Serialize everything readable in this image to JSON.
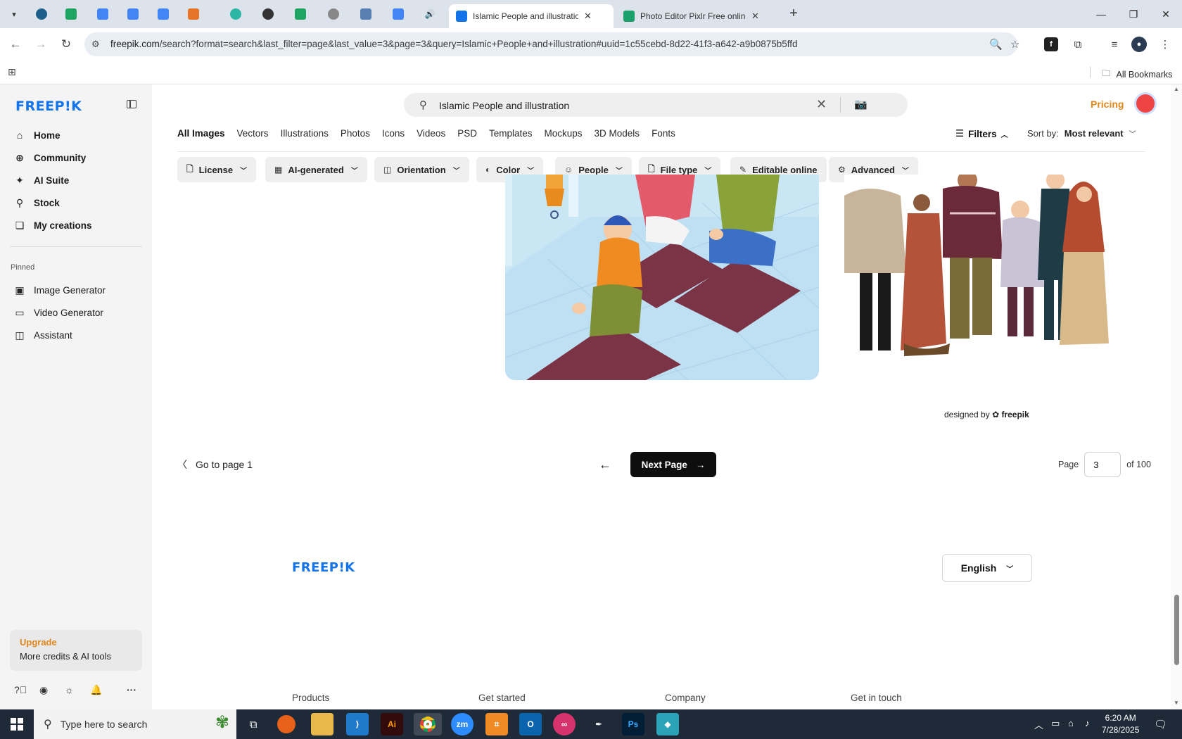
{
  "browser": {
    "tabs": [
      {
        "title": "Islamic People and illustration",
        "active": true
      },
      {
        "title": "Photo Editor Pixlr Free online Im",
        "active": false
      }
    ],
    "url_host": "freepik.com",
    "url_path": "/search?format=search&last_filter=page&last_value=3&page=3&query=Islamic+People+and+illustration#uuid=1c55cebd-8d22-41f3-a642-a9b0875b5ffd",
    "all_bookmarks": "All Bookmarks"
  },
  "sidebar": {
    "logo": "FREEP!K",
    "items": [
      {
        "label": "Home",
        "icon": "home-icon"
      },
      {
        "label": "Community",
        "icon": "globe-icon"
      },
      {
        "label": "AI Suite",
        "icon": "sparkle-icon"
      },
      {
        "label": "Stock",
        "icon": "search-icon"
      },
      {
        "label": "My creations",
        "icon": "creations-icon"
      }
    ],
    "pinned_label": "Pinned",
    "pinned": [
      {
        "label": "Image Generator",
        "icon": "image-icon"
      },
      {
        "label": "Video Generator",
        "icon": "video-icon"
      },
      {
        "label": "Assistant",
        "icon": "chat-icon"
      }
    ],
    "upgrade_title": "Upgrade",
    "upgrade_text": "More credits & AI tools"
  },
  "header": {
    "search_query": "Islamic People and illustration",
    "pricing": "Pricing"
  },
  "categories": [
    "All Images",
    "Vectors",
    "Illustrations",
    "Photos",
    "Icons",
    "Videos",
    "PSD",
    "Templates",
    "Mockups",
    "3D Models",
    "Fonts"
  ],
  "filters_label": "Filters",
  "sort": {
    "label": "Sort by:",
    "value": "Most relevant"
  },
  "chips": [
    "License",
    "AI-generated",
    "Orientation",
    "Color",
    "People",
    "File type",
    "Editable online",
    "Advanced"
  ],
  "designed_by": {
    "prefix": "designed by",
    "brand": "freepik"
  },
  "pagination": {
    "go_first": "Go to page 1",
    "next": "Next Page",
    "page_label": "Page",
    "current": "3",
    "of_label": "of 100"
  },
  "footer": {
    "logo": "FREEP!K",
    "language": "English",
    "columns": [
      "Products",
      "Get started",
      "Company",
      "Get in touch"
    ]
  },
  "taskbar": {
    "search_placeholder": "Type here to search",
    "time": "6:20 AM",
    "date": "7/28/2025"
  }
}
